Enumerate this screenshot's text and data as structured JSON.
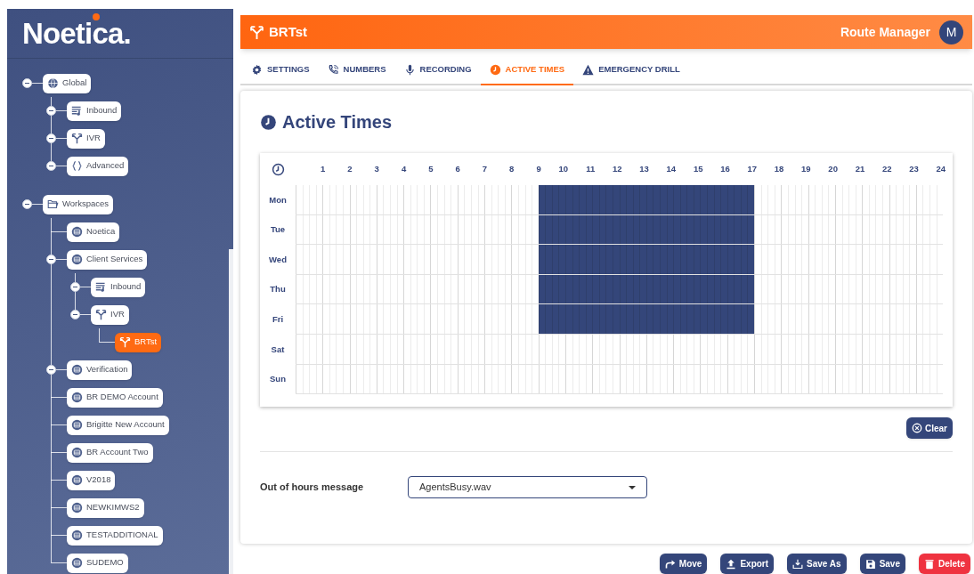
{
  "sidebar": {
    "logo": "Noetica.",
    "tree": [
      {
        "label": "Global",
        "kind": "globe",
        "toggle": true,
        "selected": false,
        "children": [
          {
            "label": "Inbound",
            "kind": "queue",
            "toggle": true,
            "selected": false
          },
          {
            "label": "IVR",
            "kind": "ivr",
            "toggle": true,
            "selected": false
          },
          {
            "label": "Advanced",
            "kind": "braces",
            "toggle": true,
            "selected": false
          }
        ]
      },
      {
        "label": "Workspaces",
        "kind": "folder",
        "toggle": true,
        "selected": false,
        "children": [
          {
            "label": "Noetica",
            "kind": "workspace",
            "toggle": false,
            "selected": false
          },
          {
            "label": "Client Services",
            "kind": "workspace",
            "toggle": true,
            "selected": false,
            "children": [
              {
                "label": "Inbound",
                "kind": "queue",
                "toggle": true,
                "selected": false
              },
              {
                "label": "IVR",
                "kind": "ivr",
                "toggle": true,
                "selected": false,
                "children": [
                  {
                    "label": "BRTst",
                    "kind": "ivr",
                    "toggle": false,
                    "selected": true
                  }
                ]
              }
            ]
          },
          {
            "label": "Verification",
            "kind": "workspace",
            "toggle": true,
            "selected": false
          },
          {
            "label": "BR DEMO Account",
            "kind": "workspace",
            "toggle": false,
            "selected": false
          },
          {
            "label": "Brigitte New Account",
            "kind": "workspace",
            "toggle": false,
            "selected": false
          },
          {
            "label": "BR Account Two",
            "kind": "workspace",
            "toggle": false,
            "selected": false
          },
          {
            "label": "V2018",
            "kind": "workspace",
            "toggle": false,
            "selected": false
          },
          {
            "label": "NEWKIMWS2",
            "kind": "workspace",
            "toggle": false,
            "selected": false
          },
          {
            "label": "TESTADDITIONAL",
            "kind": "workspace",
            "toggle": false,
            "selected": false
          },
          {
            "label": "SUDEMO",
            "kind": "workspace",
            "toggle": false,
            "selected": false
          }
        ]
      }
    ]
  },
  "header": {
    "title": "BRTst",
    "role": "Route Manager",
    "avatar": "M"
  },
  "tabs": [
    {
      "label": "SETTINGS",
      "kind": "gear",
      "selected": false
    },
    {
      "label": "NUMBERS",
      "kind": "phone",
      "selected": false
    },
    {
      "label": "RECORDING",
      "kind": "mic",
      "selected": false
    },
    {
      "label": "ACTIVE TIMES",
      "kind": "clock",
      "selected": true
    },
    {
      "label": "EMERGENCY DRILL",
      "kind": "warning",
      "selected": false
    }
  ],
  "section_title": "Active Times",
  "schedule": {
    "hours": [
      "1",
      "2",
      "3",
      "4",
      "5",
      "6",
      "7",
      "8",
      "9",
      "10",
      "11",
      "12",
      "13",
      "14",
      "15",
      "16",
      "17",
      "18",
      "19",
      "20",
      "21",
      "22",
      "23",
      "24"
    ],
    "days": [
      {
        "label": "Mon",
        "active": [
          false,
          false,
          false,
          false,
          false,
          false,
          false,
          false,
          false,
          true,
          true,
          true,
          true,
          true,
          true,
          true,
          true,
          false,
          false,
          false,
          false,
          false,
          false,
          false
        ]
      },
      {
        "label": "Tue",
        "active": [
          false,
          false,
          false,
          false,
          false,
          false,
          false,
          false,
          false,
          true,
          true,
          true,
          true,
          true,
          true,
          true,
          true,
          false,
          false,
          false,
          false,
          false,
          false,
          false
        ]
      },
      {
        "label": "Wed",
        "active": [
          false,
          false,
          false,
          false,
          false,
          false,
          false,
          false,
          false,
          true,
          true,
          true,
          true,
          true,
          true,
          true,
          true,
          false,
          false,
          false,
          false,
          false,
          false,
          false
        ]
      },
      {
        "label": "Thu",
        "active": [
          false,
          false,
          false,
          false,
          false,
          false,
          false,
          false,
          false,
          true,
          true,
          true,
          true,
          true,
          true,
          true,
          true,
          false,
          false,
          false,
          false,
          false,
          false,
          false
        ]
      },
      {
        "label": "Fri",
        "active": [
          false,
          false,
          false,
          false,
          false,
          false,
          false,
          false,
          false,
          true,
          true,
          true,
          true,
          true,
          true,
          true,
          true,
          false,
          false,
          false,
          false,
          false,
          false,
          false
        ]
      },
      {
        "label": "Sat",
        "active": [
          false,
          false,
          false,
          false,
          false,
          false,
          false,
          false,
          false,
          false,
          false,
          false,
          false,
          false,
          false,
          false,
          false,
          false,
          false,
          false,
          false,
          false,
          false,
          false
        ]
      },
      {
        "label": "Sun",
        "active": [
          false,
          false,
          false,
          false,
          false,
          false,
          false,
          false,
          false,
          false,
          false,
          false,
          false,
          false,
          false,
          false,
          false,
          false,
          false,
          false,
          false,
          false,
          false,
          false
        ]
      }
    ],
    "clear_button": "Clear"
  },
  "out_of_hours": {
    "label": "Out of hours message",
    "value": "AgentsBusy.wav"
  },
  "actions": [
    {
      "label": "Move",
      "kind": "move"
    },
    {
      "label": "Export",
      "kind": "export"
    },
    {
      "label": "Save As",
      "kind": "saveas"
    },
    {
      "label": "Save",
      "kind": "save"
    },
    {
      "label": "Delete",
      "kind": "delete"
    }
  ]
}
